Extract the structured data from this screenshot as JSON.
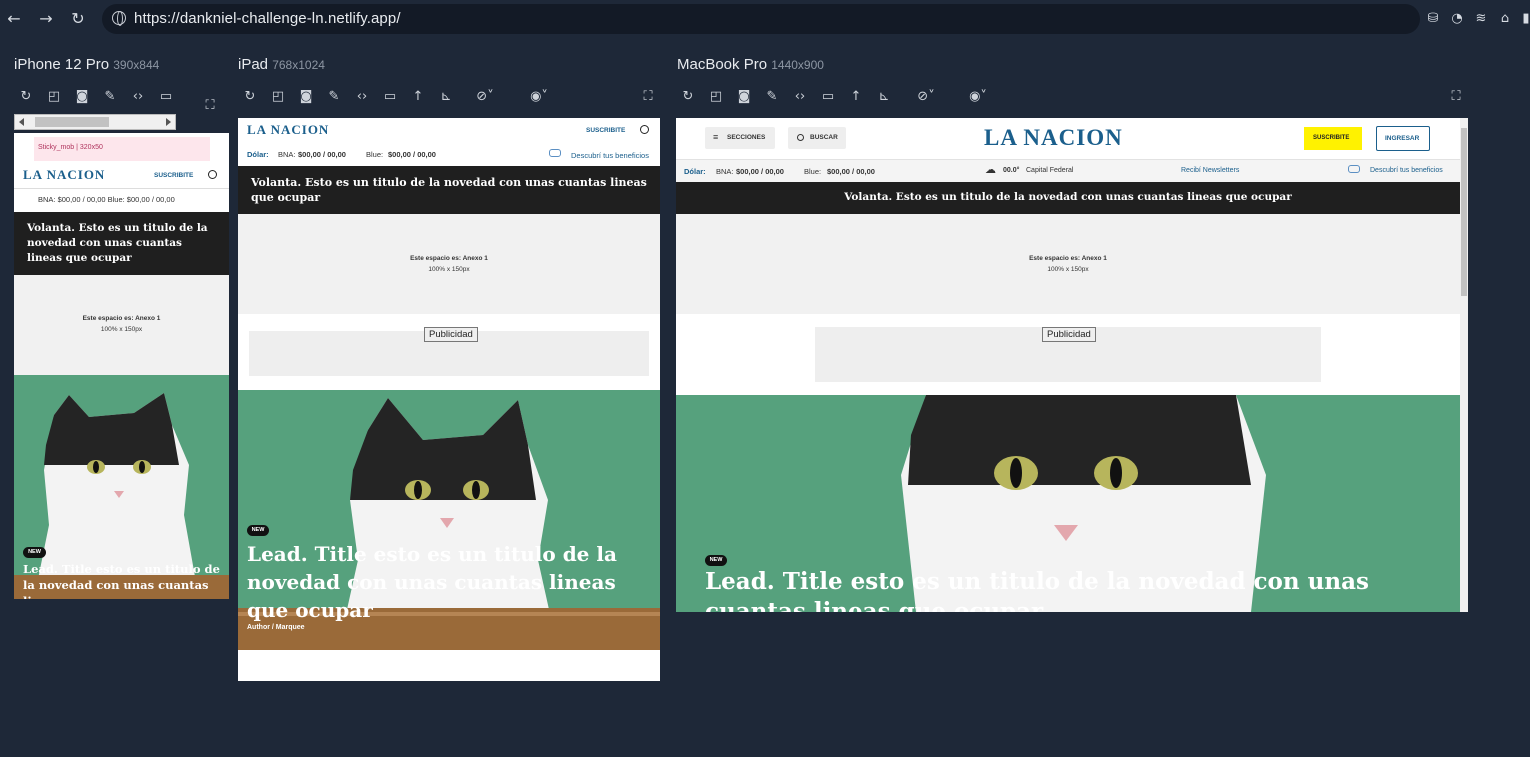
{
  "browser": {
    "url": "https://dankniel-challenge-ln.netlify.app/"
  },
  "devices": [
    {
      "name": "iPhone 12 Pro",
      "dims": "390x844"
    },
    {
      "name": "iPad",
      "dims": "768x1024"
    },
    {
      "name": "MacBook Pro",
      "dims": "1440x900"
    }
  ],
  "site": {
    "logo": "LA NACION",
    "sticky_ad": "Sticky_mob | 320x50",
    "subscribe": "SUSCRIBITE",
    "ingresar": "INGRESAR",
    "secciones": "SECCIONES",
    "buscar": "BUSCAR",
    "dolar_label": "Dólar:",
    "bna_label": "BNA:",
    "bna_value": "$00,00 / 00,00",
    "blue_label": "Blue:",
    "blue_value": "$00,00 / 00,00",
    "bna_line_mobile": "BNA: $00,00 / 00,00  Blue: $00,00 / 00,00",
    "benefits": "Descubrí tus beneficios",
    "weather_temp": "00.0°",
    "weather_city": "Capital Federal",
    "newsletters": "Recibí Newsletters",
    "volanta": "Volanta. Esto es un titulo de la novedad con unas cuantas lineas que ocupar",
    "anexo_title": "Este espacio es: Anexo 1",
    "anexo_size": "100% x 150px",
    "publicidad": "Publicidad",
    "new_badge": "NEW",
    "lead_title": "Lead. Title esto es un titulo de la novedad con unas cuantas lineas que ocupar",
    "author": "Author / Marquee"
  },
  "colors": {
    "page_bg": "#1e2838",
    "brand": "#1b5f8c",
    "subscribe_bg": "#fff200",
    "dark_band": "#1f1f1f",
    "cat_bg": "#55a07c"
  }
}
